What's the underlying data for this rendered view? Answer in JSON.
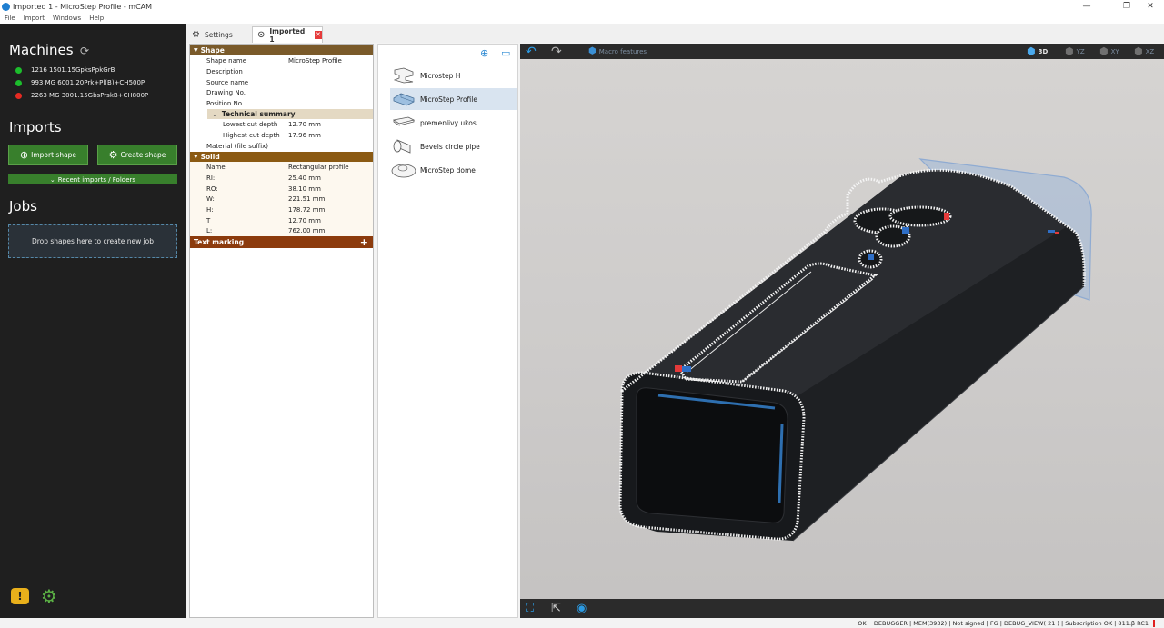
{
  "window": {
    "title": "Imported 1 - MicroStep Profile - mCAM",
    "min": "—",
    "max": "❐",
    "close": "✕"
  },
  "menu": [
    "File",
    "Import",
    "Windows",
    "Help"
  ],
  "sidebar": {
    "machines_title": "Machines",
    "machines": [
      {
        "label": "1216 1501.15GpksPpkGrB",
        "color": "#1cbd2c"
      },
      {
        "label": "993 MG 6001.20Prk+Pl(B)+CH500P",
        "color": "#1cbd2c"
      },
      {
        "label": "2263 MG  3001.15GbsPrskB+CH800P",
        "color": "#e52a22"
      }
    ],
    "imports_title": "Imports",
    "import_button": "Import shape",
    "create_button": "Create shape",
    "recent_label": "Recent imports / Folders",
    "jobs_title": "Jobs",
    "drop_label": "Drop shapes here to create new job"
  },
  "tabs": [
    {
      "label": "Settings",
      "icon": "gear-icon"
    },
    {
      "label": "Imported 1",
      "icon": "import-arrow-icon"
    }
  ],
  "properties": {
    "shape_header": "Shape",
    "shape_rows": [
      {
        "label": "Shape name",
        "value": "MicroStep Profile"
      },
      {
        "label": "Description",
        "value": ""
      },
      {
        "label": "Source name",
        "value": ""
      },
      {
        "label": "Drawing No.",
        "value": ""
      },
      {
        "label": "Position No.",
        "value": ""
      }
    ],
    "tech_header": "Technical summary",
    "tech_rows": [
      {
        "label": "Lowest cut depth",
        "value": "12.70 mm"
      },
      {
        "label": "Highest cut depth",
        "value": "17.96 mm"
      }
    ],
    "material_label": "Material (file suffix)",
    "solid_header": "Solid",
    "solid_rows": [
      {
        "label": "Name",
        "value": "Rectangular profile"
      },
      {
        "label": "RI:",
        "value": "25.40 mm"
      },
      {
        "label": "RO:",
        "value": "38.10 mm"
      },
      {
        "label": "W:",
        "value": "221.51 mm"
      },
      {
        "label": "H:",
        "value": "178.72 mm"
      },
      {
        "label": "T",
        "value": "12.70 mm"
      },
      {
        "label": "L:",
        "value": "762.00 mm"
      }
    ],
    "text_marking_header": "Text marking"
  },
  "shape_list": [
    {
      "label": "Microstep H"
    },
    {
      "label": "MicroStep Profile"
    },
    {
      "label": "premenlivy ukos"
    },
    {
      "label": "Bevels circle pipe"
    },
    {
      "label": "MicroStep dome"
    }
  ],
  "viewport": {
    "macro_label": "Macro features",
    "views": [
      "3D",
      "YZ",
      "XY",
      "XZ"
    ]
  },
  "status": "OK    DEBUGGER | MEM(3932) | Not signed | FG | DEBUG_VIEW( 21 ) | Subscription OK | 811.β RC1"
}
